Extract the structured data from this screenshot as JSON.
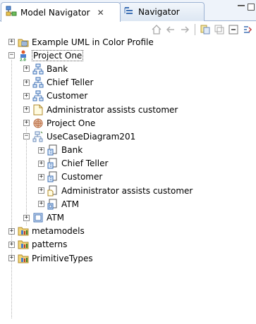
{
  "tabs": [
    {
      "label": "Model Navigator",
      "close": "✕",
      "icon": "model-navigator-icon",
      "active": true
    },
    {
      "label": "Navigator",
      "icon": "navigator-icon",
      "active": false
    }
  ],
  "toolbar": {
    "buttons": [
      "home-icon",
      "back-arrow-icon",
      "forward-arrow-icon",
      "collapse-all-icon",
      "link-editor-icon",
      "filter-icon",
      "view-menu-icon"
    ]
  },
  "tree": [
    {
      "label": "Example UML in Color Profile",
      "expander": "+",
      "icon": "profile-icon"
    },
    {
      "label": "Project One",
      "expander": "−",
      "icon": "project-icon",
      "selected": true
    },
    {
      "label": "Bank",
      "expander": "+",
      "icon": "class-icon"
    },
    {
      "label": "Chief Teller",
      "expander": "+",
      "icon": "class-icon"
    },
    {
      "label": "Customer",
      "expander": "+",
      "icon": "class-icon"
    },
    {
      "label": "Administrator assists customer",
      "expander": "+",
      "icon": "note-icon"
    },
    {
      "label": "Project One",
      "expander": "+",
      "icon": "package-icon"
    },
    {
      "label": "UseCaseDiagram201",
      "expander": "−",
      "icon": "diagram-icon"
    },
    {
      "label": "Bank",
      "expander": "+",
      "icon": "diagram-element-icon"
    },
    {
      "label": "Chief Teller",
      "expander": "+",
      "icon": "diagram-element-icon"
    },
    {
      "label": "Customer",
      "expander": "+",
      "icon": "diagram-element-icon"
    },
    {
      "label": "Administrator assists customer",
      "expander": "+",
      "icon": "diagram-note-icon"
    },
    {
      "label": "ATM",
      "expander": "+",
      "icon": "diagram-element-icon"
    },
    {
      "label": "ATM",
      "expander": "+",
      "icon": "component-icon"
    },
    {
      "label": "metamodels",
      "expander": "+",
      "icon": "library-icon"
    },
    {
      "label": "patterns",
      "expander": "+",
      "icon": "library-icon"
    },
    {
      "label": "PrimitiveTypes",
      "expander": "+",
      "icon": "library-icon"
    }
  ]
}
